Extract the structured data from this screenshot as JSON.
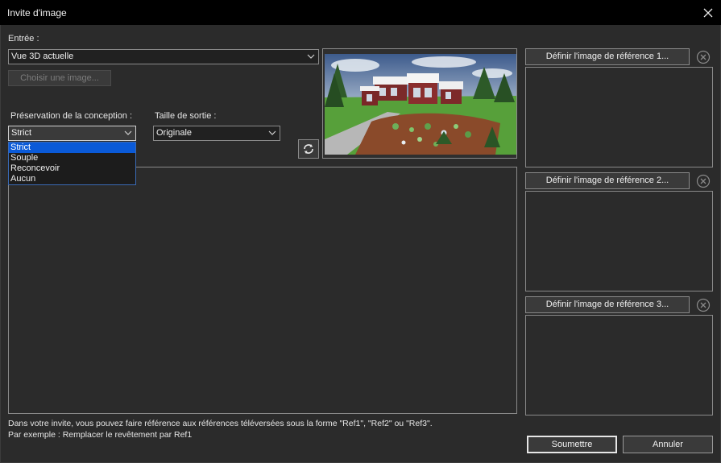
{
  "window": {
    "title": "Invite d'image",
    "close_icon": "close-icon"
  },
  "input": {
    "label": "Entrée :",
    "source_value": "Vue 3D actuelle",
    "choose_image_label": "Choisir une image..."
  },
  "preservation": {
    "label": "Préservation de la conception :",
    "value": "Strict",
    "options": [
      "Strict",
      "Souple",
      "Reconcevoir",
      "Aucun"
    ],
    "selected_index": 0
  },
  "output_size": {
    "label": "Taille de sortie :",
    "value": "Originale"
  },
  "refresh_icon": "refresh-icon",
  "references": [
    {
      "button_label": "Définir l'image de référence 1..."
    },
    {
      "button_label": "Définir l'image de référence 2..."
    },
    {
      "button_label": "Définir l'image de référence 3..."
    }
  ],
  "hints": {
    "line1": "Dans votre invite, vous pouvez faire référence aux références téléversées sous la forme \"Ref1\", \"Ref2\" ou \"Ref3\".",
    "line2": "Par exemple : Remplacer le revêtement par Ref1"
  },
  "actions": {
    "submit_label": "Soumettre",
    "cancel_label": "Annuler"
  },
  "colors": {
    "background": "#2b2b2b",
    "titlebar": "#000000",
    "selection": "#0a5ad8"
  }
}
